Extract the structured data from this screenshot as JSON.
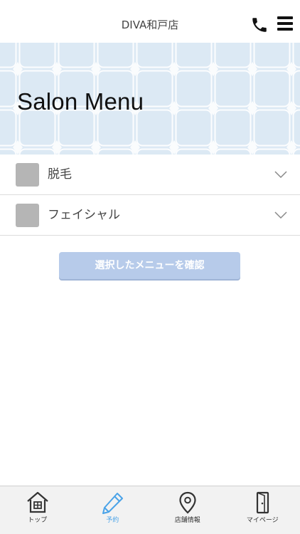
{
  "header": {
    "title": "DIVA和戸店",
    "phone_icon": "phone-icon",
    "menu_icon": "hamburger-menu-icon"
  },
  "banner": {
    "title": "Salon Menu",
    "bg_color": "#dce9f4"
  },
  "menu_items": [
    {
      "label": "脱毛"
    },
    {
      "label": "フェイシャル"
    }
  ],
  "confirm_button": {
    "label": "選択したメニューを確認",
    "color": "#b7cbea"
  },
  "tabbar": {
    "active_color": "#4aa3e8",
    "tabs": [
      {
        "label": "トップ",
        "icon": "home-icon"
      },
      {
        "label": "予約",
        "icon": "pencil-icon",
        "active": true
      },
      {
        "label": "店舗情報",
        "icon": "location-pin-icon"
      },
      {
        "label": "マイページ",
        "icon": "door-icon"
      }
    ]
  }
}
